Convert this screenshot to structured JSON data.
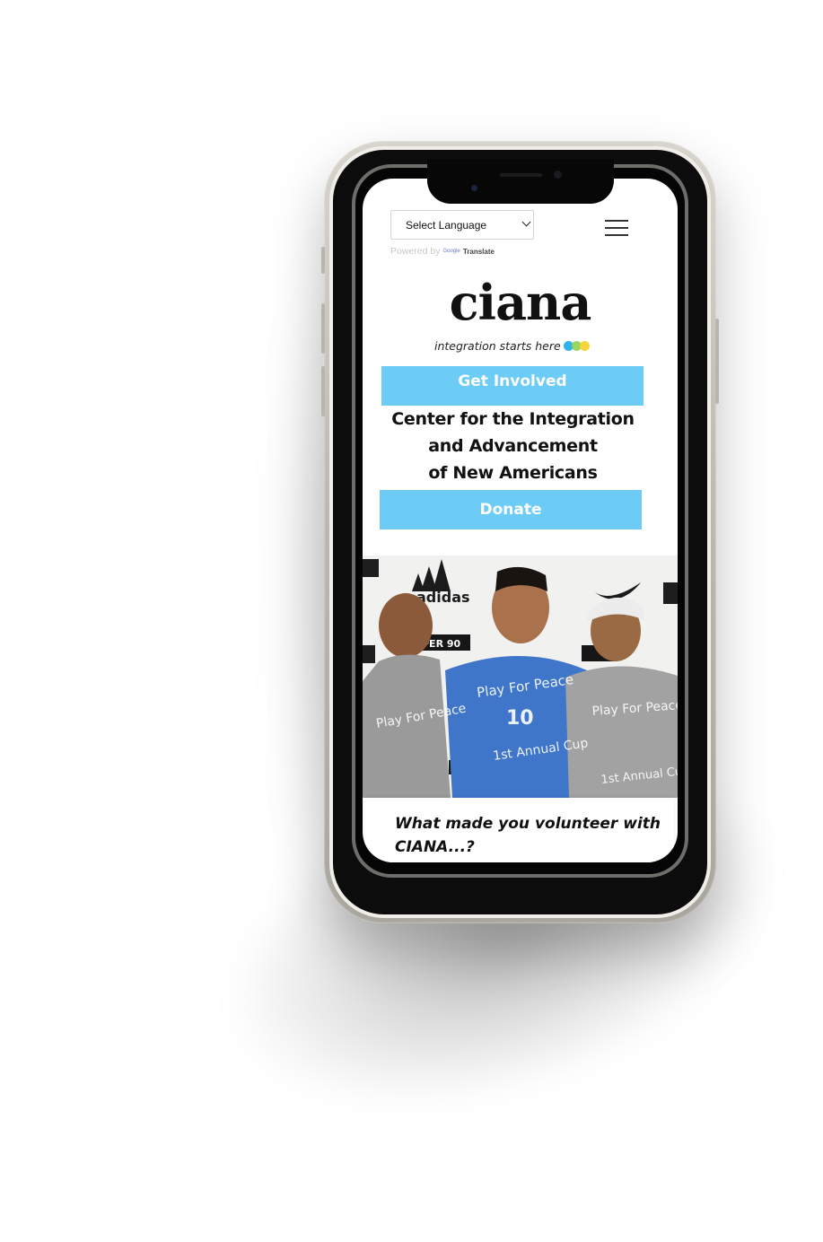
{
  "header": {
    "language_select": "Select Language",
    "powered_by": "Powered by",
    "google_label": "Google",
    "translate_label": "Translate"
  },
  "logo": {
    "name": "ciana",
    "tagline": "integration starts here"
  },
  "buttons": {
    "get_involved": "Get Involved",
    "donate": "Donate"
  },
  "headline": {
    "line1": "Center for the Integration",
    "line2": "and Advancement",
    "line3": "of New Americans"
  },
  "photo": {
    "shirt_line1": "Play For Peace",
    "shirt_number": "10",
    "shirt_line2": "1st Annual Cup",
    "backdrop_brand": "adidas",
    "backdrop_sponsor": "PER 90"
  },
  "testimonial": {
    "question": "What made you volunteer with CIANA...?"
  },
  "colors": {
    "accent_blue": "#6cccf5",
    "dot_blue": "#2fb3ea",
    "dot_green": "#8fd14f",
    "dot_yellow": "#f6d32d",
    "phone_frame": "#bdbbb2"
  },
  "icons": {
    "menu": "hamburger-menu-icon",
    "dropdown": "chevron-down-icon"
  }
}
